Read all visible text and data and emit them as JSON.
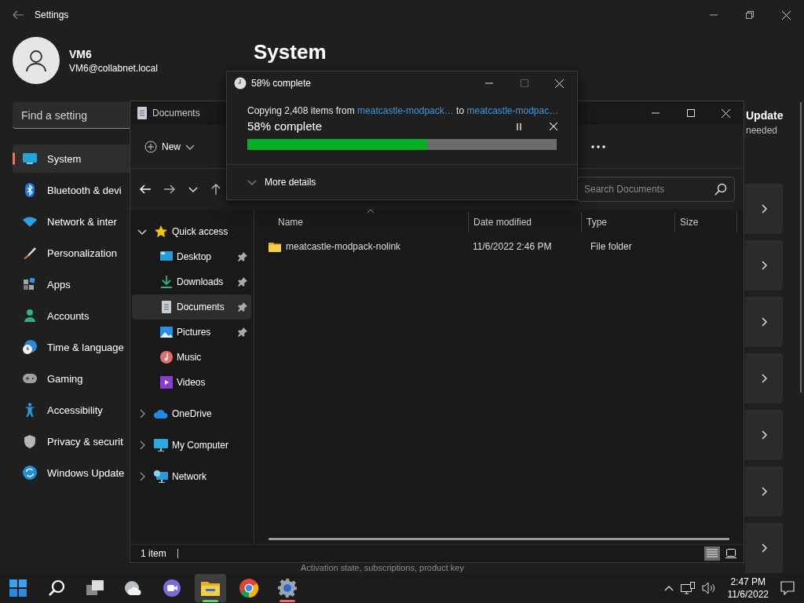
{
  "settings": {
    "title": "Settings",
    "user": {
      "name": "VM6",
      "email": "VM6@collabnet.local"
    },
    "search": {
      "placeholder": "Find a setting"
    },
    "nav": [
      {
        "label": "System",
        "kind": "system",
        "selected": true
      },
      {
        "label": "Bluetooth & devi",
        "kind": "bluetooth",
        "selected": false
      },
      {
        "label": "Network & inter",
        "kind": "network",
        "selected": false
      },
      {
        "label": "Personalization",
        "kind": "personalization",
        "selected": false
      },
      {
        "label": "Apps",
        "kind": "apps",
        "selected": false
      },
      {
        "label": "Accounts",
        "kind": "accounts",
        "selected": false
      },
      {
        "label": "Time & language",
        "kind": "time",
        "selected": false
      },
      {
        "label": "Gaming",
        "kind": "gaming",
        "selected": false
      },
      {
        "label": "Accessibility",
        "kind": "accessibility",
        "selected": false
      },
      {
        "label": "Privacy & securit",
        "kind": "privacy",
        "selected": false
      },
      {
        "label": "Windows Update",
        "kind": "update",
        "selected": false
      }
    ],
    "page_title": "System",
    "update": {
      "title": "Update",
      "subtitle": "needed"
    },
    "cards": [
      {
        "kind": "link"
      },
      {
        "kind": "link"
      },
      {
        "kind": "link"
      },
      {
        "kind": "link"
      },
      {
        "kind": "link"
      },
      {
        "kind": "link"
      },
      {
        "kind": "link"
      }
    ],
    "footer_text": "Activation state, subscriptions, product key"
  },
  "explorer": {
    "title": "Documents",
    "new_label": "New",
    "search": {
      "placeholder": "Search Documents"
    },
    "tree": [
      {
        "label": "Quick access",
        "kind": "star",
        "expanded": true,
        "selected": false,
        "children": [
          {
            "label": "Desktop",
            "kind": "desktop",
            "pinned": true,
            "selected": false
          },
          {
            "label": "Downloads",
            "kind": "downloads",
            "pinned": true,
            "selected": false
          },
          {
            "label": "Documents",
            "kind": "documents",
            "pinned": true,
            "selected": true
          },
          {
            "label": "Pictures",
            "kind": "pictures",
            "pinned": true,
            "selected": false
          },
          {
            "label": "Music",
            "kind": "music",
            "pinned": false,
            "selected": false
          },
          {
            "label": "Videos",
            "kind": "videos",
            "pinned": false,
            "selected": false
          }
        ]
      },
      {
        "label": "OneDrive",
        "kind": "cloud",
        "expanded": false,
        "selected": false
      },
      {
        "label": "My Computer",
        "kind": "computer",
        "expanded": false,
        "selected": false
      },
      {
        "label": "Network",
        "kind": "network",
        "expanded": false,
        "selected": false
      }
    ],
    "columns": [
      "Name",
      "Date modified",
      "Type",
      "Size"
    ],
    "rows": [
      {
        "name": "meatcastle-modpack-nolink",
        "date_modified": "11/6/2022 2:46 PM",
        "type": "File folder"
      }
    ],
    "status": "1 item",
    "views": [
      {
        "kind": "details",
        "selected": true
      },
      {
        "kind": "tiles",
        "selected": false
      }
    ]
  },
  "copy_dialog": {
    "title": "58% complete",
    "maximize_disabled": true,
    "message_start": "Copying 2,408 items from ",
    "source": "meatcastle-modpack…",
    "message_mid": " to ",
    "destination": "meatcastle-modpac…",
    "status": "58% complete",
    "level": 0.58,
    "details_label": "More details"
  },
  "taskbar": {
    "apps": [
      {
        "kind": "start",
        "selected": false,
        "attention": false
      },
      {
        "kind": "search",
        "selected": false,
        "attention": false
      },
      {
        "kind": "task-view",
        "selected": false,
        "attention": false
      },
      {
        "kind": "weather",
        "selected": false,
        "attention": false
      },
      {
        "kind": "chat",
        "selected": false,
        "attention": false
      },
      {
        "kind": "explorer",
        "selected": true,
        "attention": false
      },
      {
        "kind": "chrome",
        "selected": false,
        "attention": false
      },
      {
        "kind": "settings",
        "selected": false,
        "attention": true
      }
    ],
    "time": "2:47 PM",
    "date": "11/6/2022"
  }
}
